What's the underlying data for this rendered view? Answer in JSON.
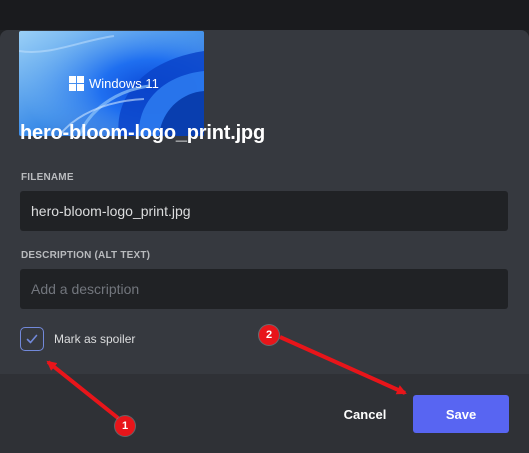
{
  "preview": {
    "image_text": "Windows 11",
    "logo_icon": "windows-logo-icon"
  },
  "file": {
    "title": "hero-bloom-logo_print.jpg"
  },
  "fields": {
    "filename_label": "FILENAME",
    "filename_value": "hero-bloom-logo_print.jpg",
    "description_label": "DESCRIPTION (ALT TEXT)",
    "description_placeholder": "Add a description"
  },
  "spoiler": {
    "label": "Mark as spoiler",
    "checked": true
  },
  "actions": {
    "cancel_label": "Cancel",
    "save_label": "Save"
  },
  "annotations": {
    "badge_1": "1",
    "badge_2": "2"
  },
  "colors": {
    "modal_bg": "#36393f",
    "footer_bg": "#2f3136",
    "input_bg": "#202225",
    "accent": "#5865f2",
    "checkbox_border": "#7289da",
    "annotation_red": "#e8151a"
  }
}
